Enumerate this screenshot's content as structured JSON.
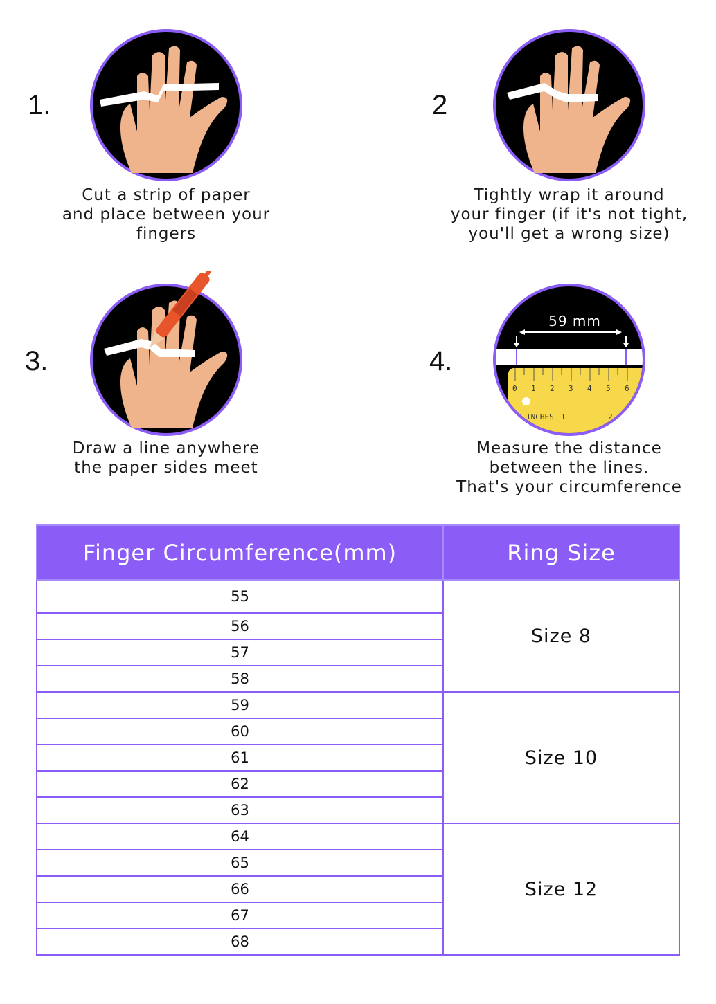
{
  "steps": [
    {
      "number": "1.",
      "caption": "Cut a strip of paper\nand place between your\nfingers",
      "icon": "hand-with-paper-strip"
    },
    {
      "number": "2",
      "caption": "Tightly wrap it around\nyour finger (if it's not tight,\nyou'll get a wrong size)",
      "icon": "hand-with-wrapped-strip"
    },
    {
      "number": "3.",
      "caption": "Draw a line anywhere\nthe paper sides meet",
      "icon": "hand-with-pen"
    },
    {
      "number": "4.",
      "caption": "Measure the distance\nbetween the lines.\nThat's your circumference",
      "icon": "ruler-measurement",
      "ruler": {
        "measure": "59 mm",
        "ticks": [
          "0",
          "1",
          "2",
          "3",
          "4",
          "5",
          "6"
        ],
        "inches_label": "INCHES",
        "inch_ticks": [
          "1",
          "2"
        ]
      }
    }
  ],
  "colors": {
    "accent": "#8b5cf6",
    "circle_bg": "#000000",
    "skin": "#f0b48c",
    "pen": "#e8552b",
    "ruler": "#f7d84a"
  },
  "table": {
    "headers": [
      "Finger Circumference(mm)",
      "Ring Size"
    ],
    "groups": [
      {
        "size": "Size 8",
        "values": [
          "55",
          "56",
          "57",
          "58"
        ]
      },
      {
        "size": "Size 10",
        "values": [
          "59",
          "60",
          "61",
          "62",
          "63"
        ]
      },
      {
        "size": "Size 12",
        "values": [
          "64",
          "65",
          "66",
          "67",
          "68"
        ]
      }
    ]
  }
}
